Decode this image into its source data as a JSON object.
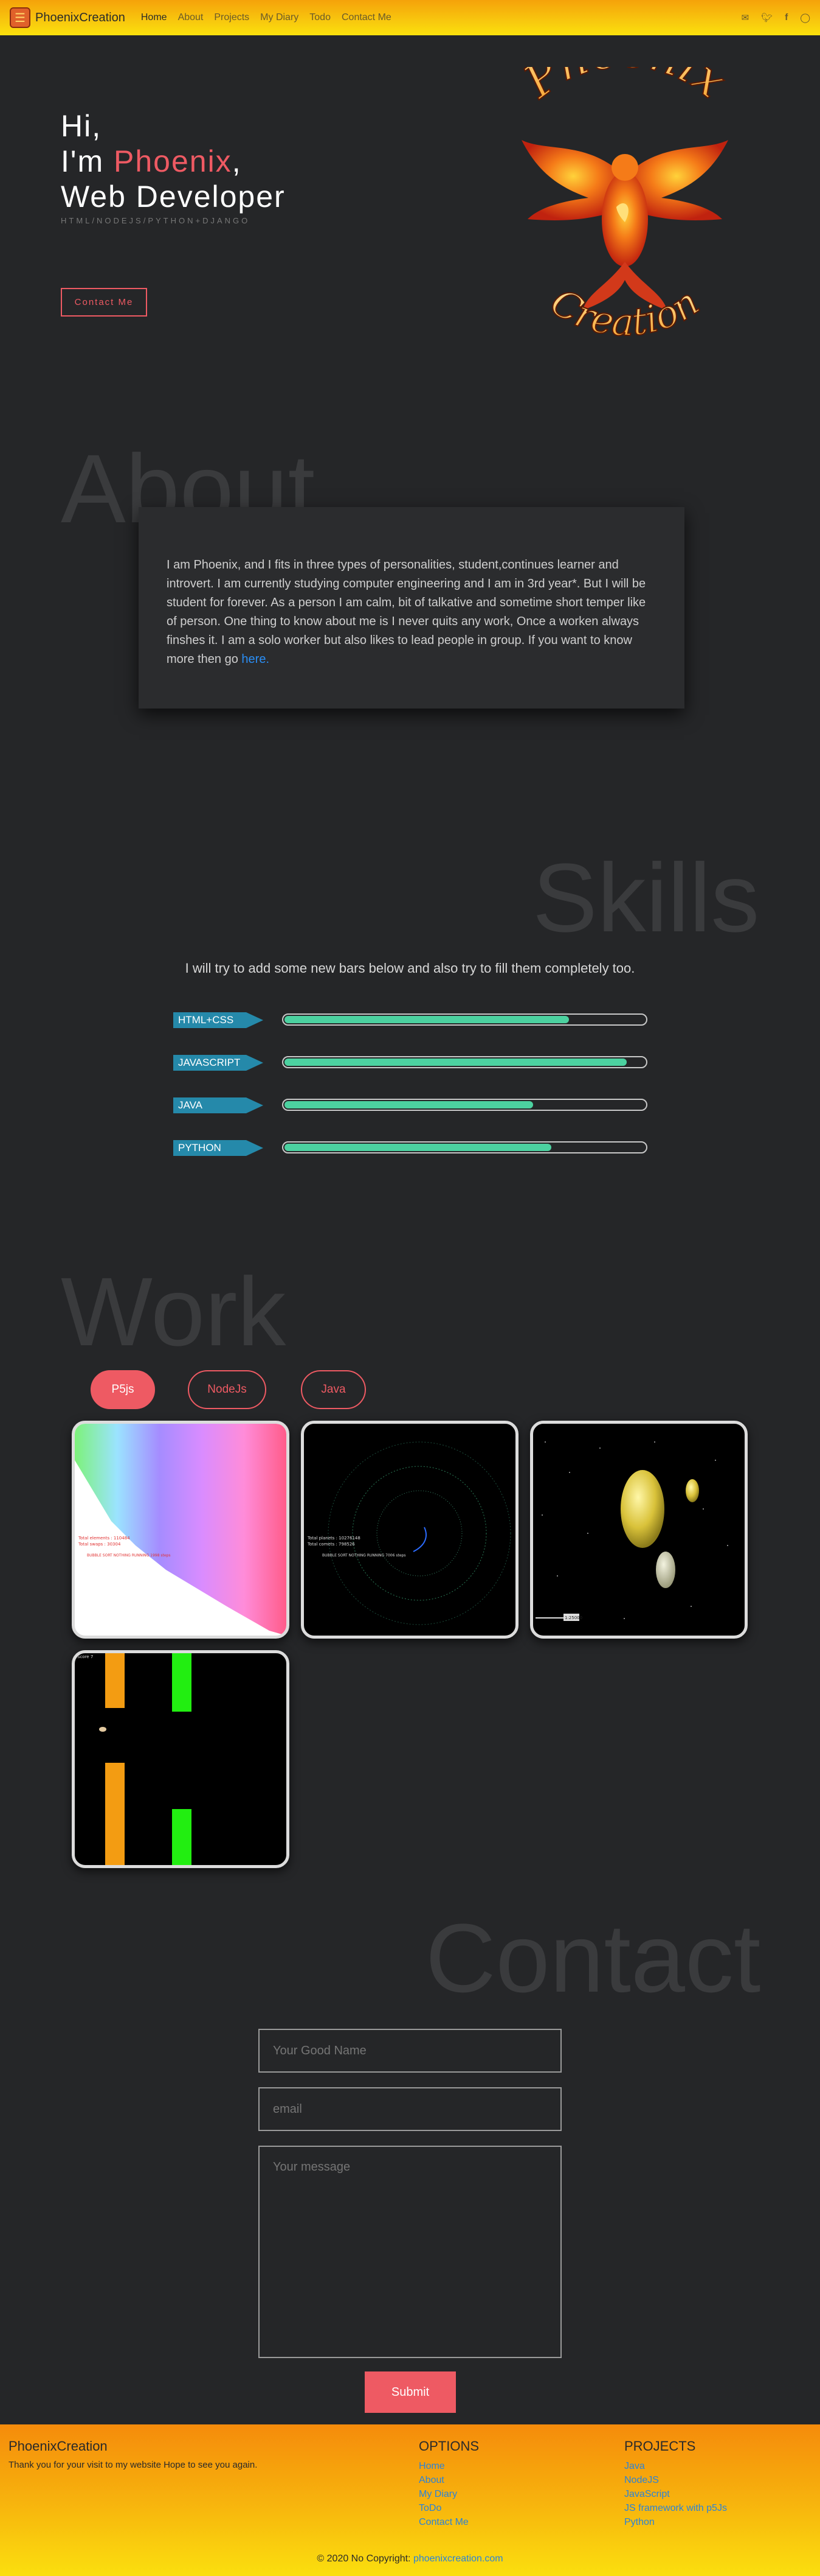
{
  "nav": {
    "brand": "PhoenixCreation",
    "links": [
      "Home",
      "About",
      "Projects",
      "My Diary",
      "Todo",
      "Contact Me"
    ],
    "active": "Home",
    "social_icons": [
      "mail-icon",
      "twitter-icon",
      "facebook-icon",
      "instagram-icon"
    ]
  },
  "hero": {
    "line1": "Hi,",
    "line2_prefix": "I'm ",
    "name": "Phoenix",
    "line2_suffix": ",",
    "line3": "Web Developer",
    "subtitle": "HTML/NODEJS/PYTHON+DJANGO",
    "button": "Contact Me",
    "logo_top": "Phoenix",
    "logo_bottom": "Creation"
  },
  "about": {
    "title": "About",
    "text": "I am Phoenix, and I fits in three types of personalities, student,continues learner and introvert. I am currently studying computer engineering and I am in 3rd year*. But I will be student for forever. As a person I am calm, bit of talkative and sometime short temper like of person. One thing to know about me is I never quits any work, Once a worken always finshes it. I am a solo worker but also likes to lead people in group. If you want to know more then go ",
    "link": "here."
  },
  "skills": {
    "title": "Skills",
    "intro": "I will try to add some new bars below and also try to fill them completely too.",
    "items": [
      {
        "label": "HTML+CSS",
        "level": 0.79
      },
      {
        "label": "JAVASCRIPT",
        "level": 0.95
      },
      {
        "label": "JAVA",
        "level": 0.69
      },
      {
        "label": "PYTHON",
        "level": 0.74
      }
    ]
  },
  "work": {
    "title": "Work",
    "filters": [
      "P5js",
      "NodeJs",
      "Java"
    ],
    "active_filter": "P5js",
    "cards": [
      {
        "name": "sorting-visualizer",
        "labels": [
          "Total elements : 110484",
          "Total swaps : 30304",
          "BUBBLE SORT NOTHING RUNNING 1998 steps"
        ]
      },
      {
        "name": "orbit-simulation",
        "labels": [
          "Total planets : 10276148",
          "Total comets : 798526",
          "BUBBLE SORT NOTHING RUNNING 7006 steps"
        ]
      },
      {
        "name": "solar-system",
        "labels": [
          "1:25000"
        ]
      },
      {
        "name": "flappy-game",
        "labels": [
          "Score 7"
        ]
      }
    ]
  },
  "contact": {
    "title": "Contact",
    "name_placeholder": "Your Good Name",
    "email_placeholder": "email",
    "message_placeholder": "Your message",
    "submit": "Submit"
  },
  "footer": {
    "brand": "PhoenixCreation",
    "tagline": "Thank you for your visit to my website Hope to see you again.",
    "options_title": "OPTIONS",
    "options": [
      "Home",
      "About",
      "My Diary",
      "ToDo",
      "Contact Me"
    ],
    "projects_title": "PROJECTS",
    "projects": [
      "Java",
      "NodeJS",
      "JavaScript",
      "JS framework with p5Js",
      "Python"
    ],
    "copyright": "© 2020 No Copyright: ",
    "copyright_link": "phoenixcreation.com"
  },
  "colors": {
    "accent": "#ee5a63",
    "skill_tag": "#2589aa",
    "skill_fill": "#4cd1a0",
    "link": "#2a8ef5",
    "nav_gradient_top": "#f5a20a",
    "nav_gradient_bottom": "#fbe10c"
  }
}
